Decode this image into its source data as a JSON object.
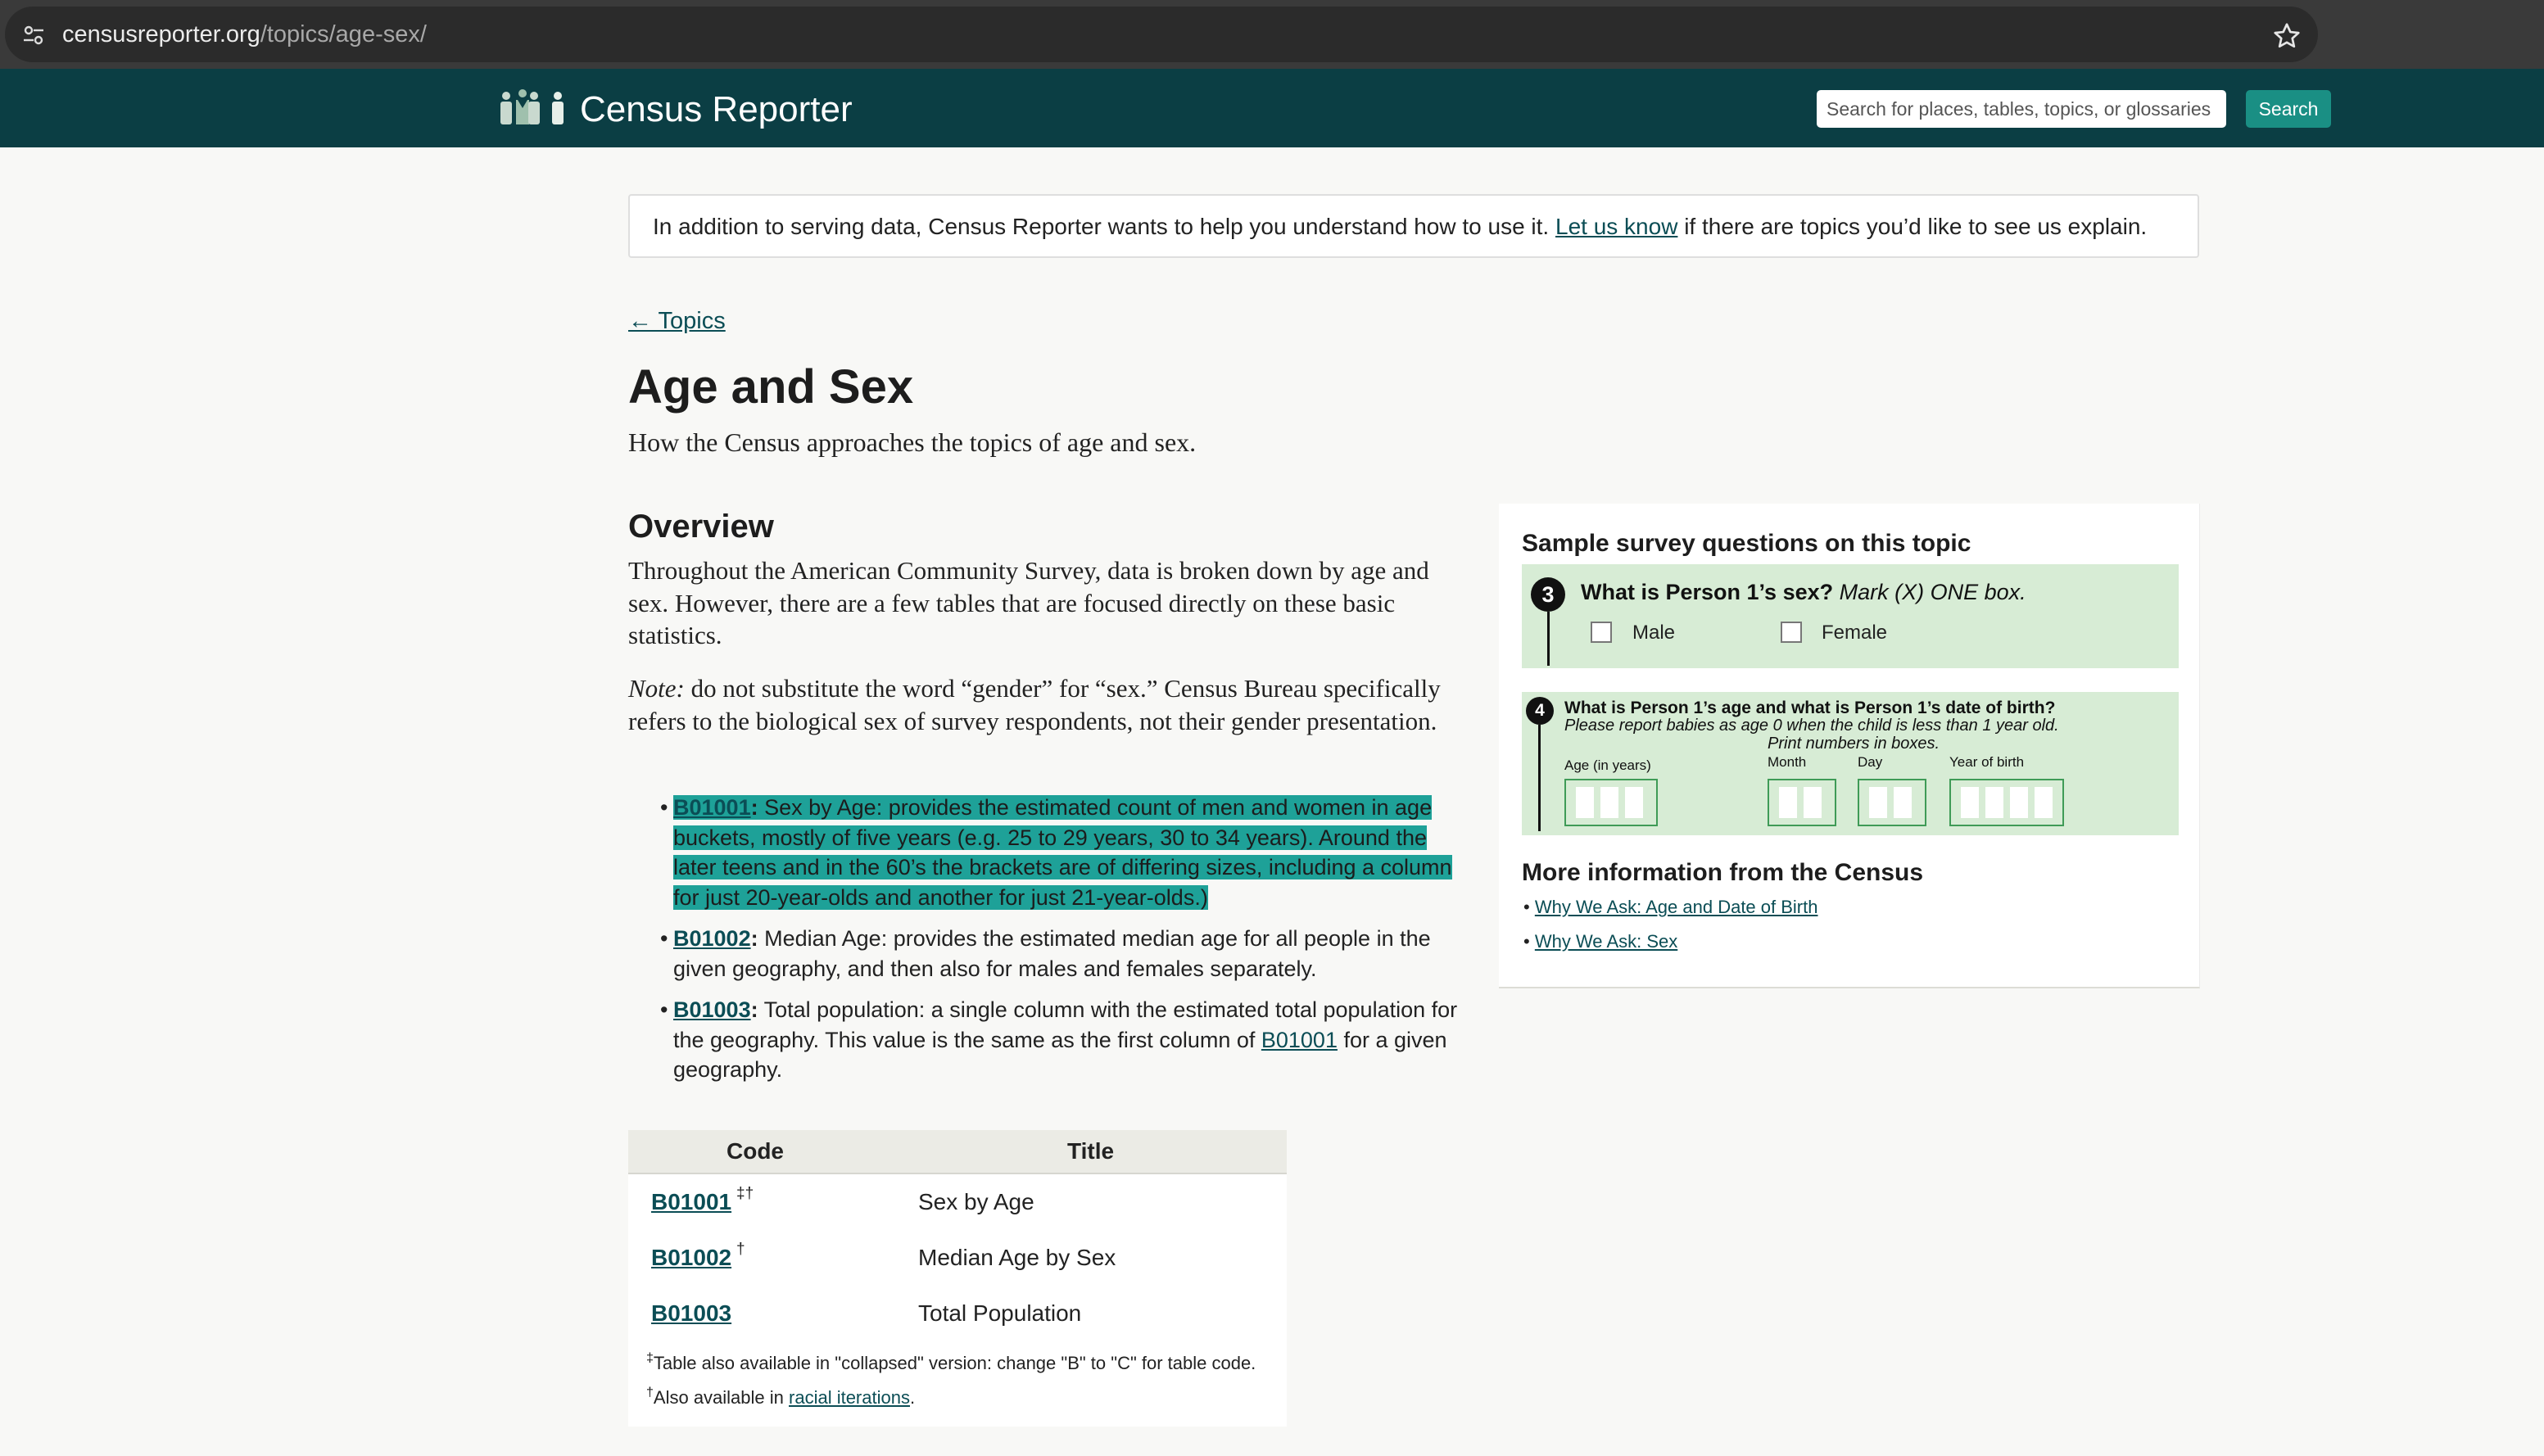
{
  "browser": {
    "url_host": "censusreporter.org",
    "url_path": "/topics/age-sex/"
  },
  "header": {
    "site_name": "Census Reporter",
    "search_placeholder": "Search for places, tables, topics, or glossaries",
    "search_button": "Search"
  },
  "banner": {
    "text_before": "In addition to serving data, Census Reporter wants to help you understand how to use it. ",
    "link": "Let us know",
    "text_after": " if there are topics you’d like to see us explain."
  },
  "back_link": "← Topics",
  "page": {
    "title": "Age and Sex",
    "subtitle": "How the Census approaches the topics of age and sex."
  },
  "overview": {
    "heading": "Overview",
    "p1": "Throughout the American Community Survey, data is broken down by age and sex. However, there are a few tables that are focused directly on these basic statistics.",
    "note_label": "Note:",
    "p2": " do not substitute the word “gender” for “sex.” Census Bureau specifically refers to the biological sex of survey respondents, not their gender presentation.",
    "bullets": [
      {
        "code": "B01001",
        "colon": ":",
        "text": " Sex by Age: provides the estimated count of men and women in age buckets, mostly of five years (e.g. 25 to 29 years, 30 to 34 years). Around the later teens and in the 60’s the brackets are of differing sizes, including a column for just 20-year-olds and another for just 21-year-olds.)"
      },
      {
        "code": "B01002",
        "colon": ":",
        "text": " Median Age: provides the estimated median age for all people in the given geography, and then also for males and females separately."
      },
      {
        "code": "B01003",
        "colon": ":",
        "text_before": " Total population: a single column with the estimated total population for the geography. This value is the same as the first column of ",
        "inline_code": "B01001",
        "text_after": " for a given geography."
      }
    ]
  },
  "table": {
    "headers": [
      "Code",
      "Title"
    ],
    "rows": [
      {
        "code": "B01001",
        "marks": "‡†",
        "title": "Sex by Age"
      },
      {
        "code": "B01002",
        "marks": "†",
        "title": "Median Age by Sex"
      },
      {
        "code": "B01003",
        "marks": "",
        "title": "Total Population"
      }
    ],
    "note1_mark": "‡",
    "note1": "Table also available in \"collapsed\" version: change \"B\" to \"C\" for table code.",
    "note2_mark": "†",
    "note2_before": "Also available in ",
    "note2_link": "racial iterations",
    "note2_after": "."
  },
  "sidebar": {
    "heading": "Sample survey questions on this topic",
    "q3": {
      "number": "3",
      "question": "What is Person 1’s sex?",
      "instruction": " Mark (X) ONE box.",
      "options": [
        "Male",
        "Female"
      ]
    },
    "q4": {
      "number": "4",
      "question": "What is Person 1’s age and what is Person 1’s date of birth?",
      "note1": "Please report babies as age 0 when the child is less than 1 year old.",
      "note2": "Print numbers in boxes.",
      "labels": [
        "Age (in years)",
        "Month",
        "Day",
        "Year of birth"
      ]
    },
    "more_heading": "More information from the Census",
    "links": [
      "Why We Ask: Age and Date of Birth",
      "Why We Ask: Sex"
    ]
  },
  "colors": {
    "header_bg": "#0b3e44",
    "accent": "#1a8f84",
    "highlight": "#1ea198",
    "survey_bg": "#d7ecd5"
  }
}
